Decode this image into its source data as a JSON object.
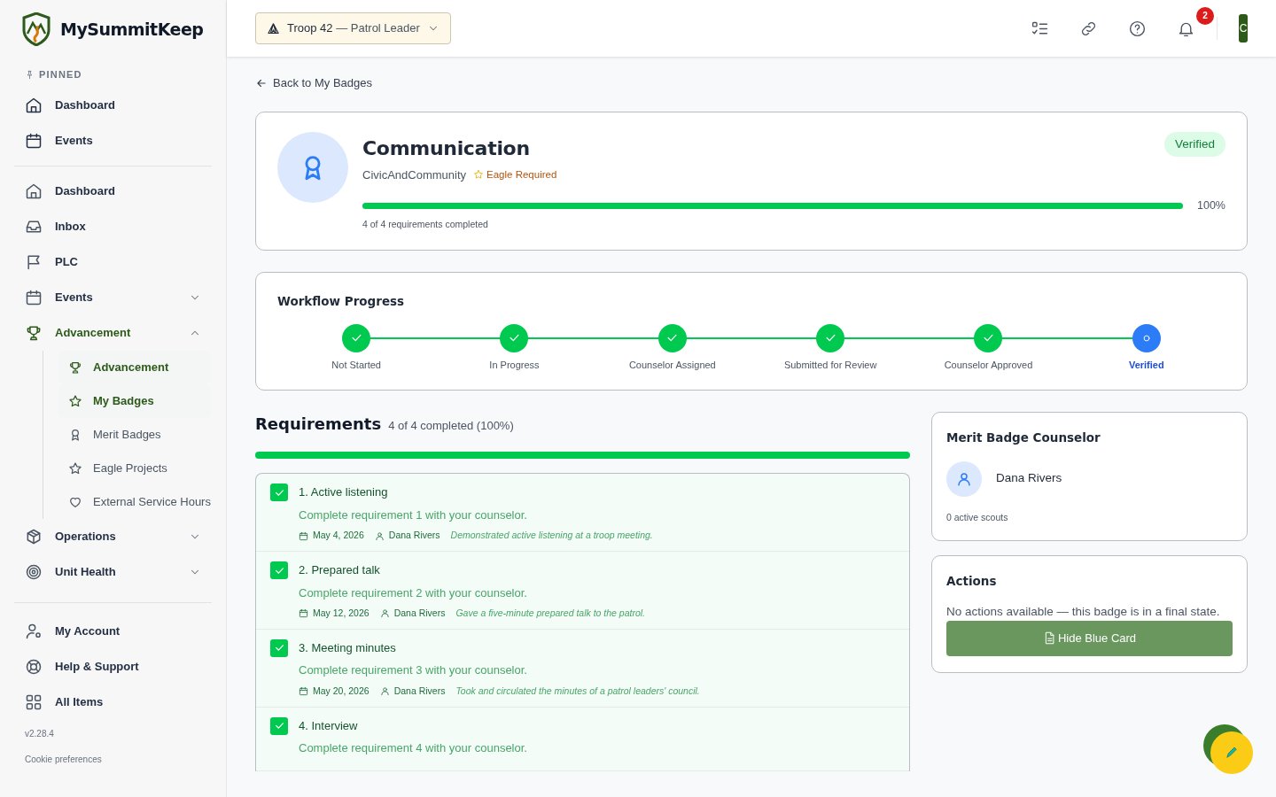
{
  "brand": {
    "name": "MySummitKeep"
  },
  "sidebar": {
    "pinned_label": "PINNED",
    "pinned": [
      {
        "label": "Dashboard"
      },
      {
        "label": "Events"
      }
    ],
    "items": [
      {
        "label": "Dashboard",
        "kind": "link",
        "active": false
      },
      {
        "label": "Inbox",
        "kind": "link",
        "active": false
      },
      {
        "label": "PLC",
        "kind": "link",
        "active": false
      },
      {
        "label": "Events",
        "kind": "group",
        "active": false,
        "expanded": false
      },
      {
        "label": "Advancement",
        "kind": "group",
        "active": true,
        "expanded": true,
        "children": [
          {
            "label": "Advancement",
            "selected": true
          },
          {
            "label": "My Badges",
            "selected": true
          },
          {
            "label": "Merit Badges",
            "selected": false
          },
          {
            "label": "Eagle Projects",
            "selected": false
          },
          {
            "label": "External Service Hours",
            "selected": false
          }
        ]
      },
      {
        "label": "Operations",
        "kind": "group",
        "active": false,
        "expanded": false
      },
      {
        "label": "Unit Health",
        "kind": "group",
        "active": false,
        "expanded": false
      }
    ],
    "bottom": [
      {
        "label": "My Account"
      },
      {
        "label": "Help & Support"
      },
      {
        "label": "All Items"
      }
    ],
    "version": "v2.28.4",
    "footer_link": "Cookie preferences"
  },
  "header": {
    "unit": "Troop 42",
    "role": "— Patrol Leader",
    "notifications": "2",
    "avatar": "C"
  },
  "back_link": "Back to My Badges",
  "badge": {
    "title": "Communication",
    "category": "CivicAndCommunity",
    "eagle_label": "Eagle Required",
    "eagle_required": true,
    "status": "Verified",
    "level": 1.0,
    "percent": "100%",
    "summary": "4 of 4 requirements completed"
  },
  "workflow": {
    "title": "Workflow Progress",
    "steps": [
      {
        "label": "Not Started",
        "completed": true,
        "current": false
      },
      {
        "label": "In Progress",
        "completed": true,
        "current": false
      },
      {
        "label": "Counselor Assigned",
        "completed": true,
        "current": false
      },
      {
        "label": "Submitted for Review",
        "completed": true,
        "current": false
      },
      {
        "label": "Counselor Approved",
        "completed": true,
        "current": false
      },
      {
        "label": "Verified",
        "completed": false,
        "current": true
      }
    ]
  },
  "requirements": {
    "title": "Requirements",
    "summary": "4 of 4 completed (100%)",
    "level": 1.0,
    "items": [
      {
        "title": "1. Active listening",
        "checked": true,
        "description": "Complete requirement 1 with your counselor.",
        "date": "May 4, 2026",
        "counselor": "Dana Rivers",
        "note": "Demonstrated active listening at a troop meeting."
      },
      {
        "title": "2. Prepared talk",
        "checked": true,
        "description": "Complete requirement 2 with your counselor.",
        "date": "May 12, 2026",
        "counselor": "Dana Rivers",
        "note": "Gave a five-minute prepared talk to the patrol."
      },
      {
        "title": "3. Meeting minutes",
        "checked": true,
        "description": "Complete requirement 3 with your counselor.",
        "date": "May 20, 2026",
        "counselor": "Dana Rivers",
        "note": "Took and circulated the minutes of a patrol leaders' council."
      },
      {
        "title": "4. Interview",
        "checked": true,
        "description": "Complete requirement 4 with your counselor."
      }
    ]
  },
  "counselor": {
    "title": "Merit Badge Counselor",
    "name": "Dana Rivers",
    "scouts": "0 active scouts"
  },
  "actions": {
    "title": "Actions",
    "message": "No actions available — this badge is in a final state.",
    "button": "Hide Blue Card"
  }
}
